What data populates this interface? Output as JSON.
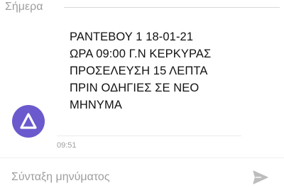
{
  "conversation": {
    "date_label": "Σήμερα"
  },
  "message": {
    "lines": [
      "ΡΑΝΤΕΒΟΥ 1 18-01-21",
      "ΩΡΑ 09:00 Γ.Ν ΚΕΡΚΥΡΑΣ",
      "ΠΡΟΣΕΛΕΥΣΗ 15 ΛΕΠΤΑ",
      "ΠΡΙΝ ΟΔΗΓΙΕΣ ΣΕ ΝΕΟ",
      "ΜΗΝΥΜΑ"
    ],
    "timestamp": "09:51",
    "sender_avatar_icon": "triangle-logo-icon",
    "avatar_color": "#6a5acd"
  },
  "composer": {
    "placeholder": "Σύνταξη μηνύματος",
    "send_icon": "send-icon",
    "send_icon_color": "#bdbdbd"
  }
}
